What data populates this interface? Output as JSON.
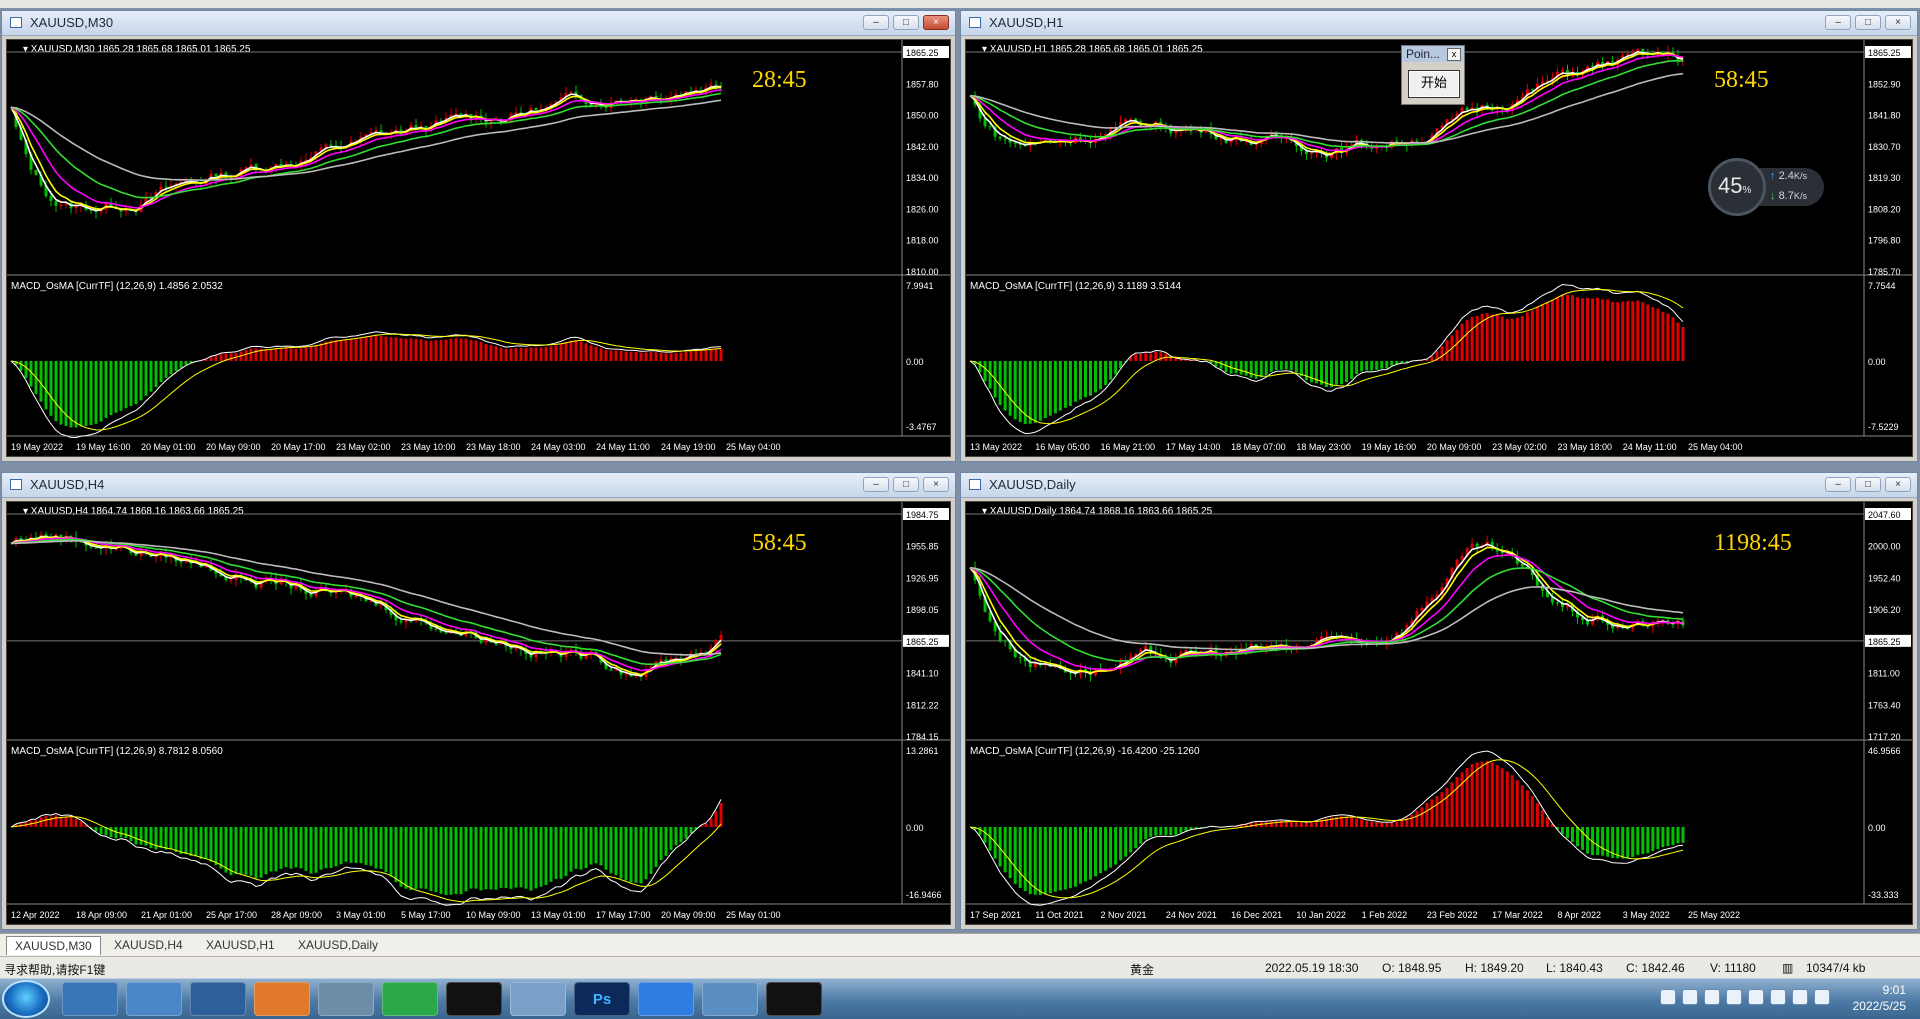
{
  "windows": [
    {
      "id": "m30",
      "title": "XAUUSD,M30",
      "symbol_line": "XAUUSD,M30  1865.28 1865.68 1865.01 1865.25",
      "timer": "28:45",
      "price_ticks": [
        "1865.25",
        "1857.80",
        "1850.00",
        "1842.00",
        "1834.00",
        "1826.00",
        "1818.00",
        "1810.00"
      ],
      "macd_line": "MACD_OsMA [CurrTF] (12,26,9) 1.4856 2.0532",
      "macd_ticks": [
        "7.9941",
        "0.00",
        "-3.4767"
      ],
      "date_ticks": [
        "19 May 2022",
        "19 May 16:00",
        "20 May 01:00",
        "20 May 09:00",
        "20 May 17:00",
        "23 May 02:00",
        "23 May 10:00",
        "23 May 18:00",
        "24 May 03:00",
        "24 May 11:00",
        "24 May 19:00",
        "25 May 04:00"
      ]
    },
    {
      "id": "h1",
      "title": "XAUUSD,H1",
      "symbol_line": "XAUUSD,H1  1865.28 1865.68 1865.01 1865.25",
      "timer": "58:45",
      "price_ticks": [
        "1865.25",
        "1852.90",
        "1841.80",
        "1830.70",
        "1819.30",
        "1808.20",
        "1796.80",
        "1785.70"
      ],
      "macd_line": "MACD_OsMA [CurrTF] (12,26,9) 3.1189 3.5144",
      "macd_ticks": [
        "7.7544",
        "0.00",
        "-7.5229"
      ],
      "date_ticks": [
        "13 May 2022",
        "16 May 05:00",
        "16 May 21:00",
        "17 May 14:00",
        "18 May 07:00",
        "18 May 23:00",
        "19 May 16:00",
        "20 May 09:00",
        "23 May 02:00",
        "23 May 18:00",
        "24 May 11:00",
        "25 May 04:00"
      ]
    },
    {
      "id": "h4",
      "title": "XAUUSD,H4",
      "symbol_line": "XAUUSD,H4  1864.74 1868.16 1863.66 1865.25",
      "timer": "58:45",
      "price_ticks": [
        "1984.75",
        "1955.85",
        "1926.95",
        "1898.05",
        "1865.25",
        "1841.10",
        "1812.22",
        "1784.15"
      ],
      "macd_line": "MACD_OsMA [CurrTF] (12,26,9) 8.7812 8.0560",
      "macd_ticks": [
        "13.2861",
        "0.00",
        "-16.9466"
      ],
      "date_ticks": [
        "12 Apr 2022",
        "18 Apr 09:00",
        "21 Apr 01:00",
        "25 Apr 17:00",
        "28 Apr 09:00",
        "3 May 01:00",
        "5 May 17:00",
        "10 May 09:00",
        "13 May 01:00",
        "17 May 17:00",
        "20 May 09:00",
        "25 May 01:00"
      ]
    },
    {
      "id": "daily",
      "title": "XAUUSD,Daily",
      "symbol_line": "XAUUSD,Daily  1864.74 1868.16 1863.66 1865.25",
      "timer": "1198:45",
      "price_ticks": [
        "2047.60",
        "2000.00",
        "1952.40",
        "1906.20",
        "1865.25",
        "1811.00",
        "1763.40",
        "1717.20"
      ],
      "macd_line": "MACD_OsMA [CurrTF] (12,26,9) -16.4200 -25.1260",
      "macd_ticks": [
        "46.9566",
        "0.00",
        "-33.333"
      ],
      "date_ticks": [
        "17 Sep 2021",
        "11 Oct 2021",
        "2 Nov 2021",
        "24 Nov 2021",
        "16 Dec 2021",
        "10 Jan 2022",
        "1 Feb 2022",
        "23 Feb 2022",
        "17 Mar 2022",
        "8 Apr 2022",
        "3 May 2022",
        "25 May 2022"
      ]
    }
  ],
  "popup": {
    "title": "Poin...",
    "close": "x",
    "button": "开始"
  },
  "network": {
    "percent": "45",
    "unit": "%",
    "up": "2.4",
    "down": "8.7",
    "rate_unit": "K/s"
  },
  "tabs": [
    "XAUUSD,M30",
    "XAUUSD,H4",
    "XAUUSD,H1",
    "XAUUSD,Daily"
  ],
  "status": {
    "help": "寻求帮助,请按F1键",
    "symbol": "黄金",
    "datetime": "2022.05.19 18:30",
    "open": "O: 1848.95",
    "high": "H: 1849.20",
    "low": "L: 1840.43",
    "close": "C: 1842.46",
    "volume": "V: 11180",
    "traffic": "10347/4 kb"
  },
  "taskbar": {
    "apps": [
      "folder",
      "explorer",
      "display",
      "media",
      "classifier",
      "wechat",
      "capcut",
      "docs",
      "photoshop",
      "feishu",
      "paint",
      "capcut2"
    ],
    "app_ps": "Ps",
    "time": "9:01",
    "date": "2022/5/25"
  },
  "colors": {
    "bull": "#00c000",
    "bear": "#e00000",
    "ema_white": "#ffffff",
    "ema_yellow": "#ffff00",
    "ema_magenta": "#ff00ff",
    "ema_green": "#33dd33",
    "ema_gray": "#bbbbbb",
    "timer": "#ffd700"
  }
}
